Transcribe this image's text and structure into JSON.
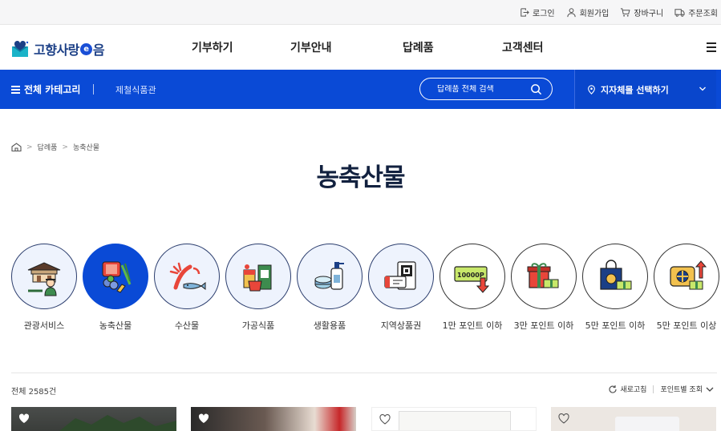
{
  "topbar": {
    "links": [
      {
        "label": "로그인",
        "icon": "login-icon"
      },
      {
        "label": "회원가입",
        "icon": "user-icon"
      },
      {
        "label": "장바구니",
        "icon": "cart-icon"
      },
      {
        "label": "주문조회",
        "icon": "delivery-truck-icon"
      }
    ]
  },
  "header": {
    "logo_text_1": "고향사랑",
    "logo_e": "e",
    "logo_text_2": "음",
    "menu": [
      "기부하기",
      "기부안내",
      "답례품",
      "고객센터"
    ]
  },
  "navbar": {
    "category_label": "전체 카테고리",
    "link": "제철식품관",
    "search_placeholder": "답례품 전체 검색",
    "region_label": "지자체몰 선택하기"
  },
  "breadcrumb": {
    "items": [
      "답례품",
      "농축산물"
    ]
  },
  "page": {
    "title": "농축산물"
  },
  "categories": [
    {
      "label": "관광서비스",
      "icon": "tourism-icon",
      "active": false
    },
    {
      "label": "농축산물",
      "icon": "agriculture-icon",
      "active": true
    },
    {
      "label": "수산물",
      "icon": "seafood-icon",
      "active": false
    },
    {
      "label": "가공식품",
      "icon": "processed-food-icon",
      "active": false
    },
    {
      "label": "생활용품",
      "icon": "household-goods-icon",
      "active": false
    },
    {
      "label": "지역상품권",
      "icon": "gift-voucher-icon",
      "active": false
    },
    {
      "label": "1만 포인트 이하",
      "icon": "point-voucher-icon",
      "active": false,
      "voucher_text": "10000P"
    },
    {
      "label": "3만 포인트 이하",
      "icon": "gift-box-icon",
      "active": false
    },
    {
      "label": "5만 포인트 이하",
      "icon": "shopping-bag-icon",
      "active": false
    },
    {
      "label": "5만 포인트 이상",
      "icon": "premium-gift-icon",
      "active": false
    }
  ],
  "list": {
    "total_label": "전체 2585건",
    "refresh_label": "새로고침",
    "sort_label": "포인트별 조회"
  },
  "colors": {
    "primary": "#0a4ad6",
    "dark_navy": "#12213f",
    "light_circle": "#eef3fd"
  }
}
